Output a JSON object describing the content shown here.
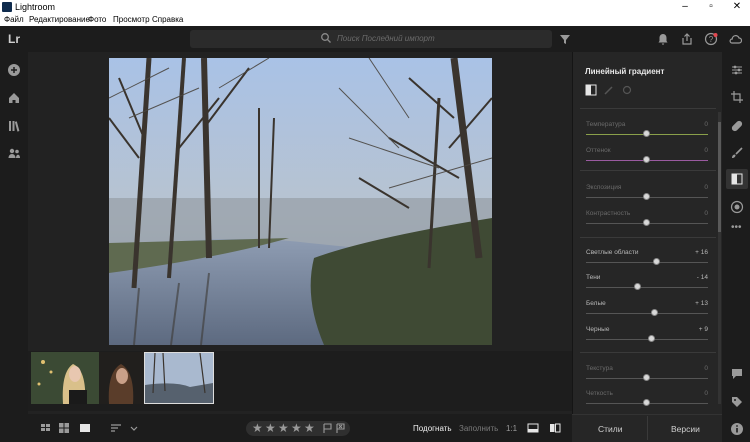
{
  "window": {
    "title": "Lightroom"
  },
  "menu": {
    "items": [
      "Файл",
      "Редактирование",
      "Фото",
      "Просмотр",
      "Справка"
    ]
  },
  "app": {
    "logo": "Lr"
  },
  "search": {
    "placeholder": "Поиск Последний импорт"
  },
  "top_icons": [
    "filter-icon",
    "bell-icon",
    "share-icon",
    "help-icon",
    "cloud-sync-icon"
  ],
  "left_rail_icons": [
    "add-icon",
    "home-icon",
    "library-icon",
    "people-icon"
  ],
  "right_rail_icons": [
    "edit-sliders-icon",
    "crop-icon",
    "healing-icon",
    "brush-icon",
    "gradient-icon",
    "radial-icon",
    "more-icon",
    "comment-icon",
    "tag-icon",
    "info-icon"
  ],
  "panel": {
    "title": "Линейный градиент",
    "sliders": [
      {
        "label": "Температура",
        "value": "0",
        "level": 0.5,
        "disabled": true
      },
      {
        "label": "Оттенок",
        "value": "0",
        "level": 0.5,
        "disabled": true
      },
      {
        "label": "Экспозиция",
        "value": "0",
        "level": 0.5,
        "disabled": true
      },
      {
        "label": "Контрастность",
        "value": "0",
        "level": 0.5,
        "disabled": true
      },
      {
        "label": "Светлые области",
        "value": "+ 16",
        "level": 0.58,
        "disabled": false
      },
      {
        "label": "Тени",
        "value": "- 14",
        "level": 0.43,
        "disabled": false
      },
      {
        "label": "Белые",
        "value": "+ 13",
        "level": 0.565,
        "disabled": false
      },
      {
        "label": "Черные",
        "value": "+ 9",
        "level": 0.545,
        "disabled": false
      },
      {
        "label": "Текстура",
        "value": "0",
        "level": 0.5,
        "disabled": true
      },
      {
        "label": "Четкость",
        "value": "0",
        "level": 0.5,
        "disabled": true
      }
    ],
    "bottom": {
      "styles": "Стили",
      "versions": "Версии"
    }
  },
  "bottombar": {
    "stars_count": 5,
    "fit": "Подогнать",
    "fill": "Заполнить",
    "one_to_one": "1:1"
  },
  "colors": {
    "accent": "#1473e6",
    "temperature_track": "#8aa04a",
    "tint_track": "#9a5aa0"
  }
}
